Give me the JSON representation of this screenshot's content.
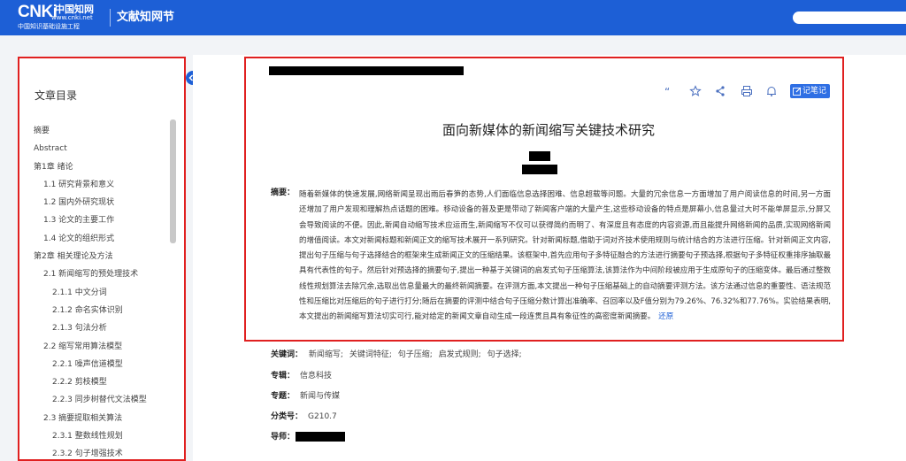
{
  "header": {
    "logo_main": "CNKi",
    "logo_cn": "中国知网",
    "logo_url": "www.cnki.net",
    "logo_sub": "中国知识基础设施工程",
    "site_name": "文献知网节",
    "search_placeholder": ""
  },
  "toc": {
    "title": "文章目录",
    "items": [
      {
        "label": "摘要",
        "level": 1
      },
      {
        "label": "Abstract",
        "level": 1
      },
      {
        "label": "第1章 绪论",
        "level": 1
      },
      {
        "label": "1.1 研究背景和意义",
        "level": 2
      },
      {
        "label": "1.2 国内外研究现状",
        "level": 2
      },
      {
        "label": "1.3 论文的主要工作",
        "level": 2
      },
      {
        "label": "1.4 论文的组织形式",
        "level": 2
      },
      {
        "label": "第2章 相关理论及方法",
        "level": 1
      },
      {
        "label": "2.1 新闻缩写的预处理技术",
        "level": 2
      },
      {
        "label": "2.1.1 中文分词",
        "level": 3
      },
      {
        "label": "2.1.2 命名实体识别",
        "level": 3
      },
      {
        "label": "2.1.3 句法分析",
        "level": 3
      },
      {
        "label": "2.2 缩写常用算法模型",
        "level": 2
      },
      {
        "label": "2.2.1 噪声信道模型",
        "level": 3
      },
      {
        "label": "2.2.2 剪枝模型",
        "level": 3
      },
      {
        "label": "2.2.3 同步树替代文法模型",
        "level": 3
      },
      {
        "label": "2.3 摘要提取相关算法",
        "level": 2
      },
      {
        "label": "2.3.1 整数线性规划",
        "level": 3
      },
      {
        "label": "2.3.2 句子增强技术",
        "level": 3
      }
    ]
  },
  "toolbar": {
    "icons": [
      "quote-icon",
      "star-icon",
      "share-icon",
      "print-icon",
      "bell-icon"
    ],
    "note_label": "记笔记"
  },
  "paper": {
    "title": "面向新媒体的新闻缩写关键技术研究",
    "abstract_label": "摘要：",
    "abstract": "随着新媒体的快速发展,网络新闻呈现出雨后春笋的态势,人们面临信息选择困难、信息超载等问题。大量的冗余信息一方面增加了用户阅读信息的时间,另一方面还增加了用户发现和理解热点话题的困难。移动设备的普及更是带动了新闻客户端的大量产生,这些移动设备的特点是屏幕小,信息量过大时不能单屏显示,分屏又会导致阅读的不便。因此,新闻自动缩写技术应运而生,新闻缩写不仅可以获得简约而明了、有深度且有态度的内容资源,而且能提升网络新闻的品质,实现网络新闻的增值阅读。本文对新闻标题和新闻正文的缩写技术展开一系列研究。针对新闻标题,借助于词对齐技术使用规则与统计结合的方法进行压缩。针对新闻正文内容,提出句子压缩与句子选择结合的框架来生成新闻正文的压缩结果。该框架中,首先应用句子多特征融合的方法进行摘要句子预选择,根据句子多特征权重排序抽取最具有代表性的句子。然后针对预选择的摘要句子,提出一种基于关键词的启发式句子压缩算法,该算法作为中间阶段被应用于生成原句子的压缩变体。最后通过整数线性规划算法去除冗余,选取出信息量最大的最终新闻摘要。在评测方面,本文提出一种句子压缩基础上的自动摘要评测方法。该方法通过信息的重要性、语法规范性和压缩比对压缩后的句子进行打分;随后在摘要的评测中结合句子压缩分数计算出准确率、召回率以及F值分别为79.26%、76.32%和77.76%。实验结果表明,本文提出的新闻缩写算法切实可行,能对给定的新闻文章自动生成一段连贯且具有象征性的高密度新闻摘要。",
    "restore_label": "还原",
    "keywords_label": "关键词：",
    "keywords": [
      "新闻缩写;",
      "关键词特征;",
      "句子压缩;",
      "启发式规则;",
      "句子选择;"
    ],
    "major_label": "专辑：",
    "major": "信息科技",
    "topic_label": "专题：",
    "topic": "新闻与传媒",
    "class_label": "分类号：",
    "class_no": "G210.7",
    "advisor_label": "导师："
  },
  "colors": {
    "brand": "#1d5fd6",
    "highlight": "#e02020"
  }
}
